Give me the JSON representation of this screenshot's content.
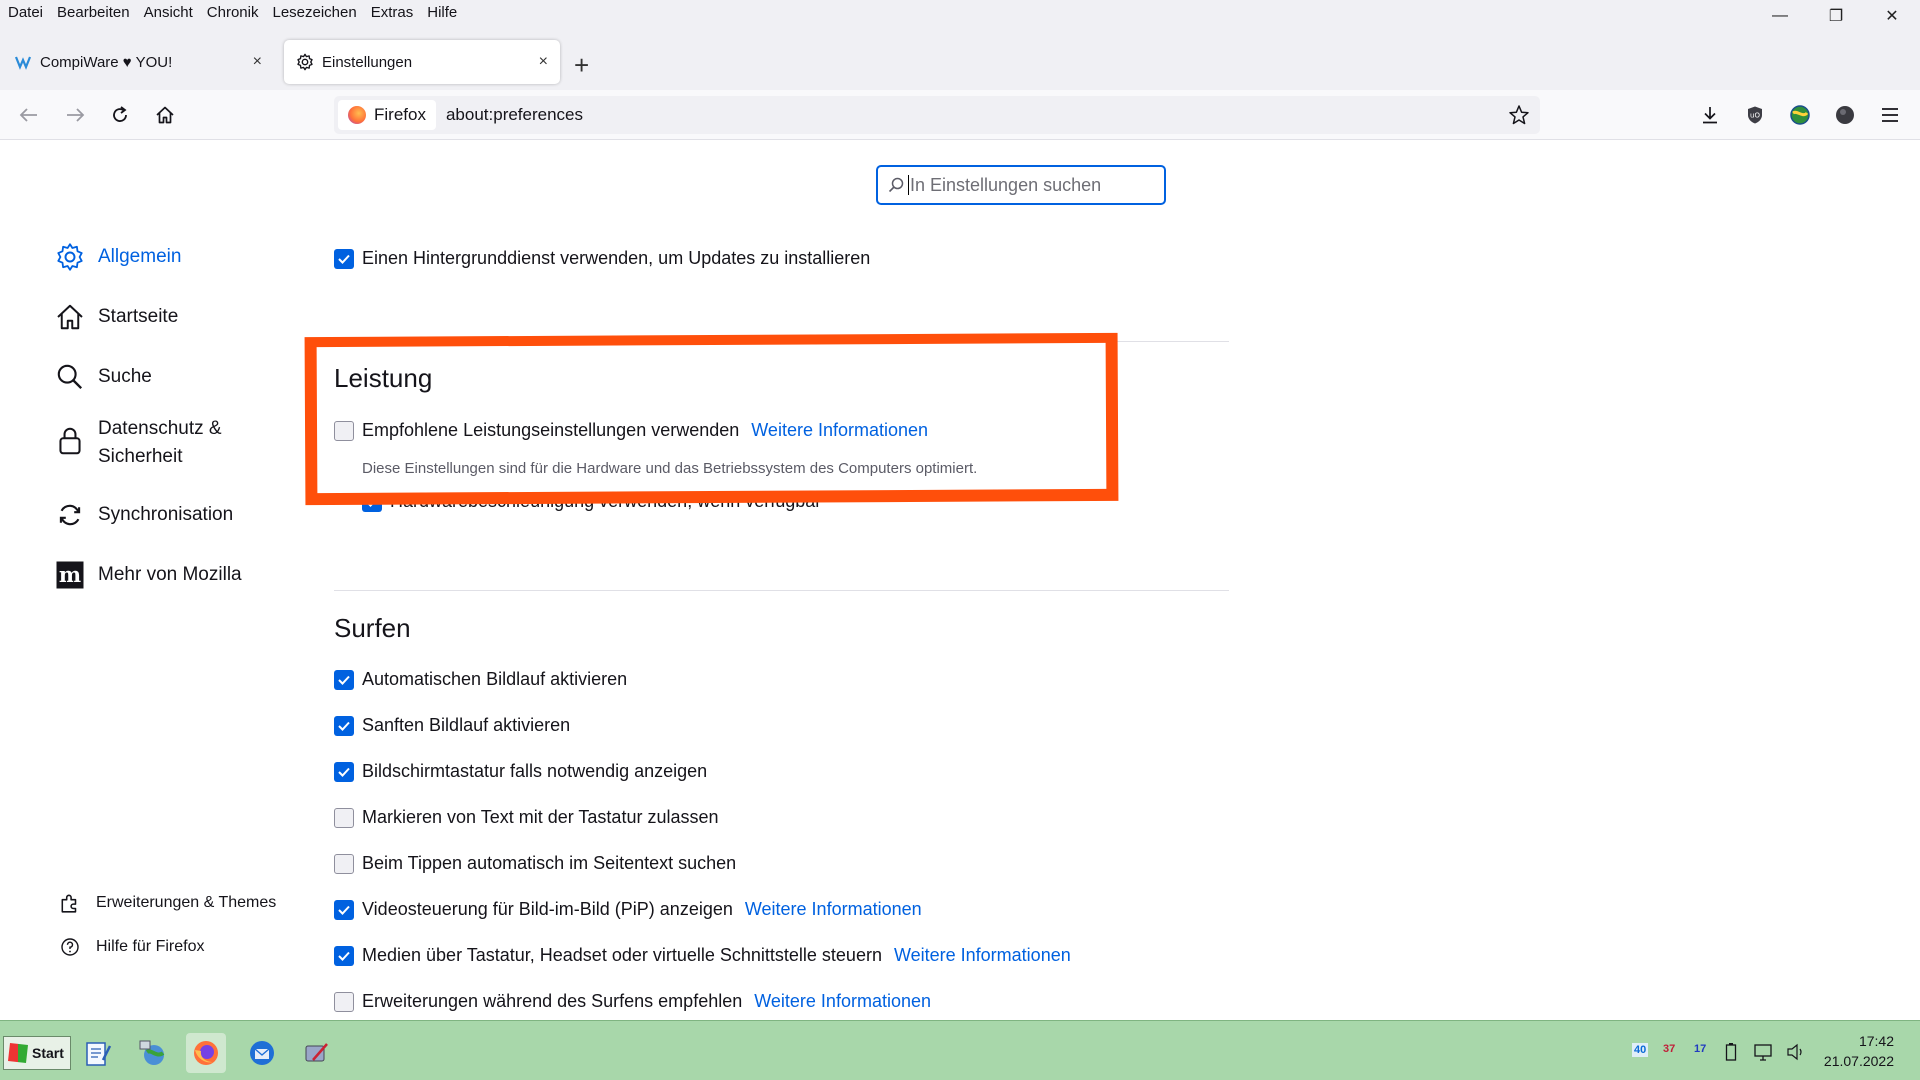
{
  "menubar": {
    "items": [
      "Datei",
      "Bearbeiten",
      "Ansicht",
      "Chronik",
      "Lesezeichen",
      "Extras",
      "Hilfe"
    ]
  },
  "window_controls": {
    "minimize": "—",
    "restore": "❐",
    "close": "✕"
  },
  "tabs": [
    {
      "label": "CompiWare ♥ YOU!",
      "icon": "compiware-icon",
      "active": false
    },
    {
      "label": "Einstellungen",
      "icon": "gear-icon",
      "active": true
    }
  ],
  "tab_close": "×",
  "newtab_label": "+",
  "urlbar": {
    "identity_label": "Firefox",
    "url": "about:preferences"
  },
  "search": {
    "placeholder": "In Einstellungen suchen"
  },
  "sidebar": {
    "items": [
      {
        "label": "Allgemein",
        "icon": "gear-icon",
        "active": true
      },
      {
        "label": "Startseite",
        "icon": "home-icon"
      },
      {
        "label": "Suche",
        "icon": "search-icon"
      },
      {
        "label": "Datenschutz & Sicherheit",
        "line1": "Datenschutz &",
        "line2": "Sicherheit",
        "icon": "lock-icon"
      },
      {
        "label": "Synchronisation",
        "icon": "sync-icon"
      },
      {
        "label": "Mehr von Mozilla",
        "icon": "mozilla-icon"
      }
    ],
    "footer": [
      {
        "label": "Erweiterungen & Themes",
        "icon": "puzzle-icon"
      },
      {
        "label": "Hilfe für Firefox",
        "icon": "help-icon"
      }
    ]
  },
  "settings": {
    "updates_bg": {
      "label": "Einen Hintergrunddienst verwenden, um Updates zu installieren",
      "checked": true
    },
    "performance": {
      "heading": "Leistung",
      "recommended": {
        "label": "Empfohlene Leistungseinstellungen verwenden",
        "checked": false,
        "link": "Weitere Informationen"
      },
      "description": "Diese Einstellungen sind für die Hardware und das Betriebssystem des Computers optimiert.",
      "hw_accel": {
        "label": "Hardwarebeschleunigung verwenden, wenn verfügbar",
        "checked": true
      }
    },
    "browsing": {
      "heading": "Surfen",
      "options": [
        {
          "label": "Automatischen Bildlauf aktivieren",
          "checked": true
        },
        {
          "label": "Sanften Bildlauf aktivieren",
          "checked": true
        },
        {
          "label": "Bildschirmtastatur falls notwendig anzeigen",
          "checked": true
        },
        {
          "label": "Markieren von Text mit der Tastatur zulassen",
          "checked": false
        },
        {
          "label": "Beim Tippen automatisch im Seitentext suchen",
          "checked": false
        },
        {
          "label": "Videosteuerung für Bild-im-Bild (PiP) anzeigen",
          "checked": true,
          "link": "Weitere Informationen"
        },
        {
          "label": "Medien über Tastatur, Headset oder virtuelle Schnittstelle steuern",
          "checked": true,
          "link": "Weitere Informationen"
        },
        {
          "label": "Erweiterungen während des Surfens empfehlen",
          "checked": false,
          "link": "Weitere Informationen"
        }
      ]
    }
  },
  "annotation": {
    "color": "#ff4f0b"
  },
  "taskbar": {
    "start_label": "Start",
    "tray": {
      "cpu": "40",
      "temp1": "37",
      "temp2": "17"
    },
    "clock": {
      "time": "17:42",
      "date": "21.07.2022"
    }
  },
  "colors": {
    "accent": "#0061e0",
    "taskbar_bg": "#a8d7aa"
  }
}
